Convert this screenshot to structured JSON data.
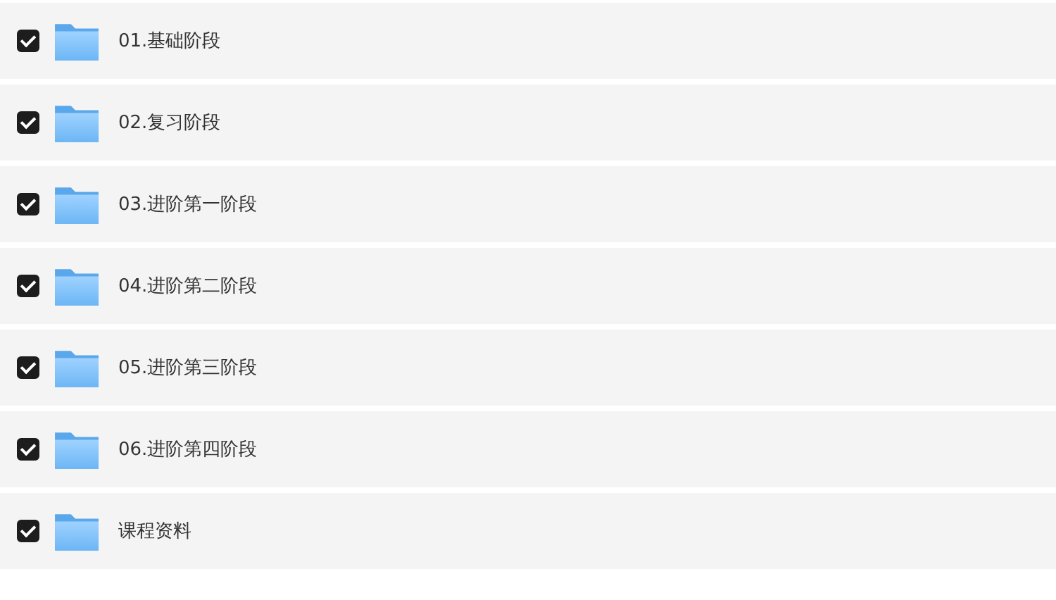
{
  "folders": [
    {
      "name": "01.基础阶段",
      "checked": true
    },
    {
      "name": "02.复习阶段",
      "checked": true
    },
    {
      "name": "03.进阶第一阶段",
      "checked": true
    },
    {
      "name": "04.进阶第二阶段",
      "checked": true
    },
    {
      "name": "05.进阶第三阶段",
      "checked": true
    },
    {
      "name": "06.进阶第四阶段",
      "checked": true
    },
    {
      "name": "课程资料",
      "checked": true
    }
  ]
}
